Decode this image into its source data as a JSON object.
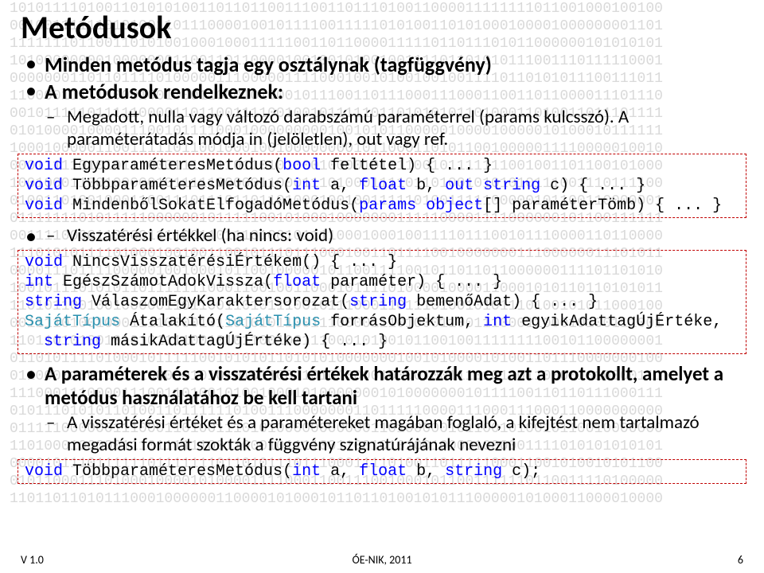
{
  "title": "Metódusok",
  "bullets": {
    "b1": "Minden metódus tagja egy osztálynak (tagfüggvény)",
    "b2": "A metódusok rendelkeznek:",
    "s1": "Megadott, nulla vagy változó darabszámú paraméterrel (params kulcsszó). A paraméterátadás módja in (jelöletlen), out vagy ref.",
    "s2": "Visszatérési értékkel (ha nincs: void)",
    "b3": "A paraméterek és a visszatérési értékek határozzák meg azt a protokollt, amelyet a metódus használatához be kell tartani",
    "s3": "A visszatérési értéket és a paramétereket magában foglaló, a kifejtést nem tartalmazó megadási formát szokták a függvény szignatúrájának nevezni"
  },
  "code1": {
    "l1a": "void",
    "l1b": " EgyparaméteresMetódus(",
    "l1c": "bool",
    "l1d": " feltétel) { ... }",
    "l2a": "void",
    "l2b": " TöbbparaméteresMetódus(",
    "l2c": "int",
    "l2d": " a, ",
    "l2e": "float",
    "l2f": " b, ",
    "l2g": "out",
    "l2h": " ",
    "l2i": "string",
    "l2j": " c) { ... }",
    "l3a": "void",
    "l3b": " MindenbőlSokatElfogadóMetódus(",
    "l3c": "params",
    "l3d": " ",
    "l3e": "object",
    "l3f": "[] paraméterTömb) { ... }"
  },
  "code2": {
    "l1a": "void",
    "l1b": " NincsVisszatérésiÉrtékem() { ... }",
    "l2a": "int",
    "l2b": " EgészSzámotAdokVissza(",
    "l2c": "float",
    "l2d": " paraméter) { ... }",
    "l3a": "string",
    "l3b": " VálaszomEgyKaraktersorozat(",
    "l3c": "string",
    "l3d": " bemenőAdat) { ... }",
    "l4a": "SajátTípus",
    "l4b": " Átalakító(",
    "l4c": "SajátTípus",
    "l4d": " forrásObjektum, ",
    "l4e": "int",
    "l4f": " egyikAdattagÚjÉrtéke,",
    "l5a": "  ",
    "l5b": "string",
    "l5c": " másikAdattagÚjÉrtéke) { ... }"
  },
  "code3": {
    "l1a": "void",
    "l1b": " TöbbparaméteresMetódus(",
    "l1c": "int",
    "l1d": " a, ",
    "l1e": "float",
    "l1f": " b, ",
    "l1g": "string",
    "l1h": " c);"
  },
  "footer": {
    "left": "V 1.0",
    "mid": "ÓE-NIK, 2011",
    "right": "6"
  },
  "binary_rows": [
    "1010111101001101010100110110110011100110111010011000011111111011001000100100",
    "0010011111101010011011100001001011110011111010100110101000100001000000001101",
    "1111111011001101010010001000111110011011000011111011011101011000000101010101",
    "1010000000010000000110011011000010010010100100111101101010111001110111110001",
    "0000000110110111101000001110000011110001001010010010011110110101011100111011",
    "1100001111110001001000110001010001011100110111000111000110011011000011101110",
    "0010111110111110000110110011110010010111110110101010110100011010011011101111",
    "0101000010000111001011110001000000000100101011000001000010000010100010111111",
    "1000100000110011111011001000100100000000101100011010110010000011110000010010",
    "0001111101010111000111101101101010001000010101100101111111001001101100101000",
    "1001000110010000010111110000011000111010001111011010010101010111001110111100",
    "0100110100100011001110111011011010001001001111101001111100000101100110000001",
    "0111111101011111000000101111100101000100000001111100001111000000101100111111",
    "0011110000110000111100110111010010111100010001001111011100101110000110110000",
    "1110101011110100010010011001011101110001001101111001000000011100000011101011",
    "0000111011110000010010001011001000001011001111001011011011000000111101101010",
    "1001011101010110111111100011001001100010111101000010000110001010110110101011",
    "1101011001001000001101100110101110010111000110111010010101110100101011000100",
    "0011110100100011110000101101010110011100001110100011001110001100010100111001",
    "1101101010010101011110010101100100111000101001011001001111111100101100000001",
    "0110101111010001011111001010101101010100000001001010000101001101110000000100",
    "0110000100101101000001010101011001101010000100001001110101101100001010000111",
    "1110001110000111001101001010010001010000000101000000010111100110110111000111",
    "0101110101011010011011111101001110000000110111110000111000111000110000000000",
    "0111110000001110001101001110101000000000001101000001011001010010110010000000",
    "1101000100000111011111100110001011110011001010100100001000001111010101010101",
    "0000101110111111011111110110101110111000111101001101111100011001010010101100",
    "0101100011101000100001010000111100011001110010001011001111110110011110100000",
    "1101101101011100010000001100001010001011011010010101110000010100011000010000"
  ]
}
